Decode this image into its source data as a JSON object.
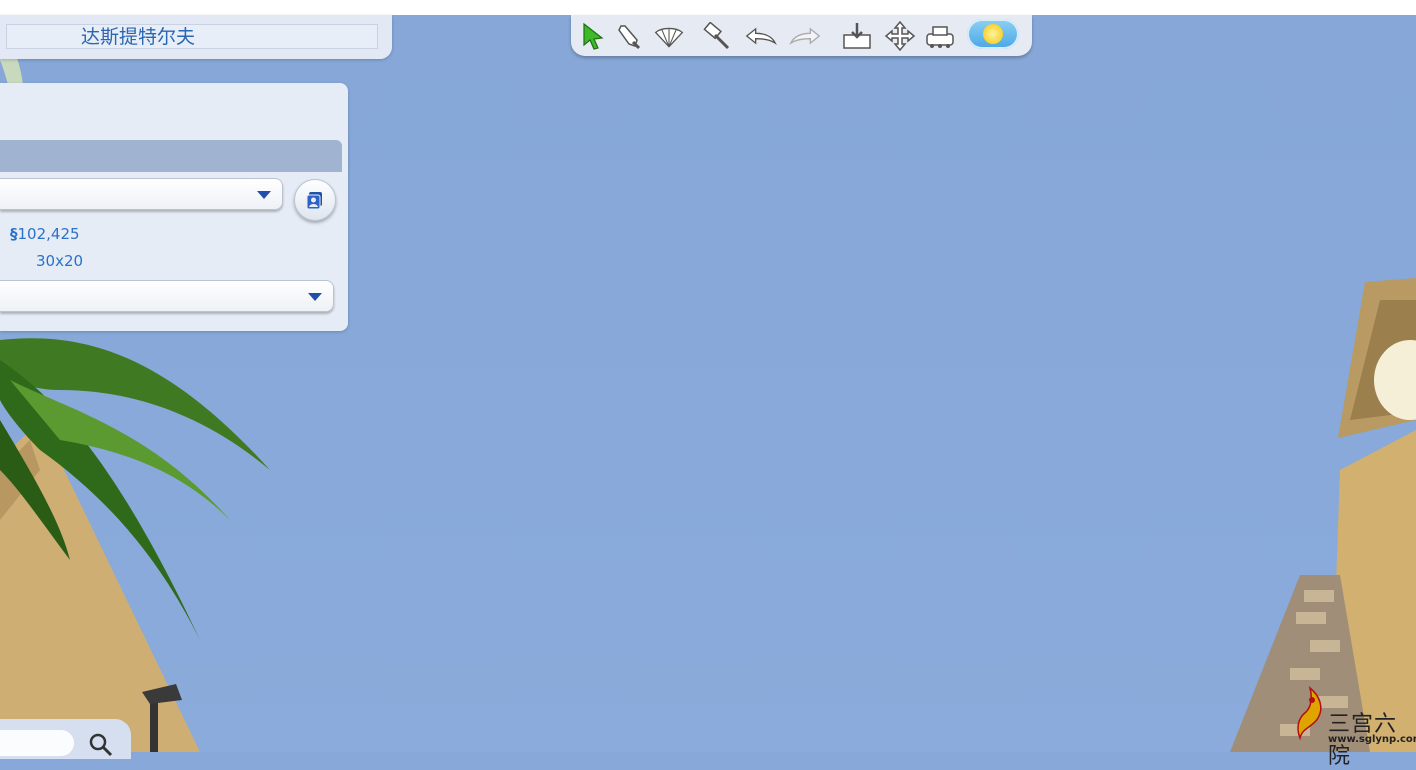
{
  "lot": {
    "name": "达斯提特尔夫"
  },
  "info": {
    "currency_symbol": "§",
    "price": "102,425",
    "size": "30x20"
  },
  "toolbar": {
    "icons": [
      "select-arrow-icon",
      "eyedropper-icon",
      "design-tool-icon",
      "sledgehammer-icon",
      "undo-icon",
      "redo-icon",
      "place-on-lot-icon",
      "move-lot-icon",
      "camera-tool-icon",
      "weather-icon"
    ]
  },
  "watermark": {
    "text": "三宫六院",
    "url": "www.sglynp.com"
  },
  "colors": {
    "accent": "#2a72c8",
    "sky": "#87a8d8",
    "panel": "#e6ecf6"
  }
}
